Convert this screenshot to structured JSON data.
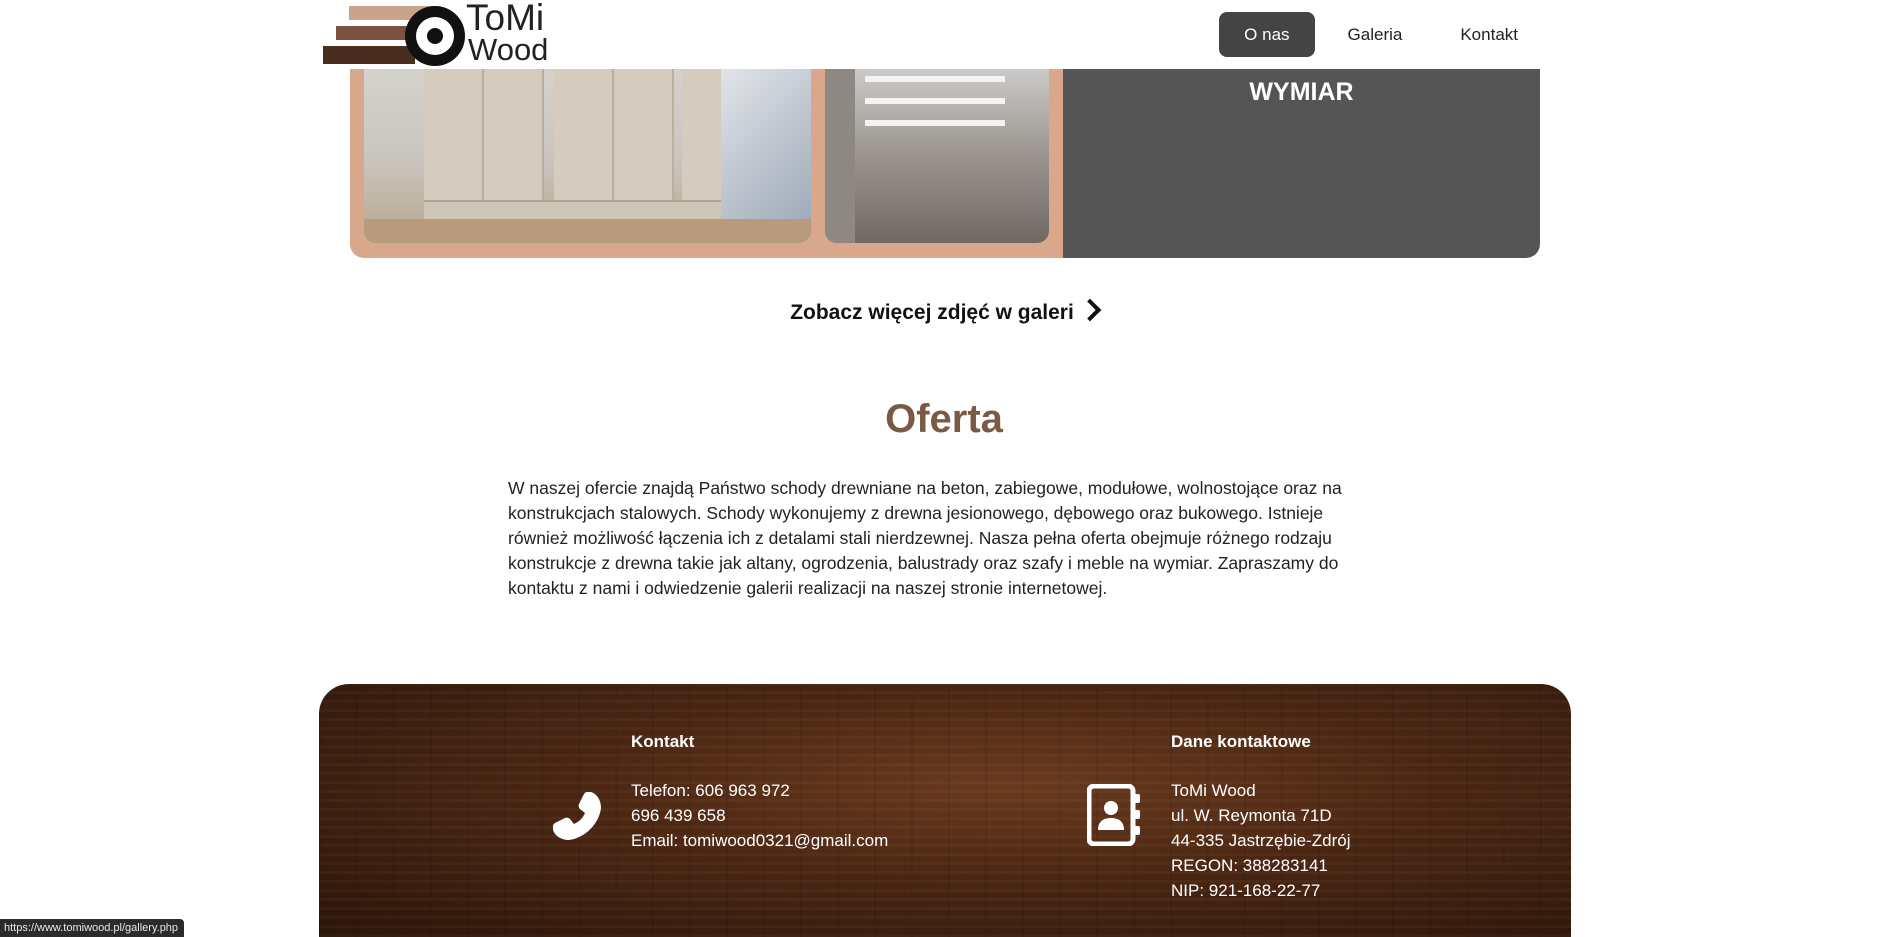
{
  "header": {
    "logo": {
      "line1": "ToMi",
      "line2": "Wood"
    },
    "nav": [
      {
        "label": "O nas",
        "active": true
      },
      {
        "label": "Galeria",
        "active": false
      },
      {
        "label": "Kontakt",
        "active": false
      }
    ]
  },
  "hero": {
    "overlay_text": "WYMIAR"
  },
  "gallery_link": {
    "label": "Zobacz więcej zdjęć w galeri"
  },
  "offer": {
    "title": "Oferta",
    "body": "W naszej ofercie znajdą Państwo schody drewniane na beton, zabiegowe, modułowe, wolnostojące oraz na konstrukcjach stalowych. Schody wykonujemy z drewna jesionowego, dębowego oraz bukowego. Istnieje również możliwość łączenia ich z detalami stali nierdzewnej. Nasza pełna oferta obejmuje różnego rodzaju konstrukcje z drewna takie jak altany, ogrodzenia, balustrady oraz szafy i meble na wymiar. Zapraszamy do kontaktu z nami i odwiedzenie galerii realizacji na naszej stronie internetowej."
  },
  "footer": {
    "contact": {
      "title": "Kontakt",
      "icon": "phone-icon",
      "lines": [
        "Telefon: 606 963 972",
        "696 439 658",
        "Email: tomiwood0321@gmail.com"
      ]
    },
    "details": {
      "title": "Dane kontaktowe",
      "icon": "contact-card-icon",
      "lines": [
        "ToMi Wood",
        "ul. W. Reymonta 71D",
        "44-335 Jastrzębie-Zdrój",
        "REGON: 388283141",
        "NIP: 921-168-22-77"
      ]
    }
  },
  "status_bar": {
    "url": "https://www.tomiwood.pl/gallery.php"
  },
  "colors": {
    "nav_active_bg": "#444444",
    "offer_title": "#7b5a45",
    "hero_panel": "#555555",
    "hero_frame": "#d9a88c"
  }
}
